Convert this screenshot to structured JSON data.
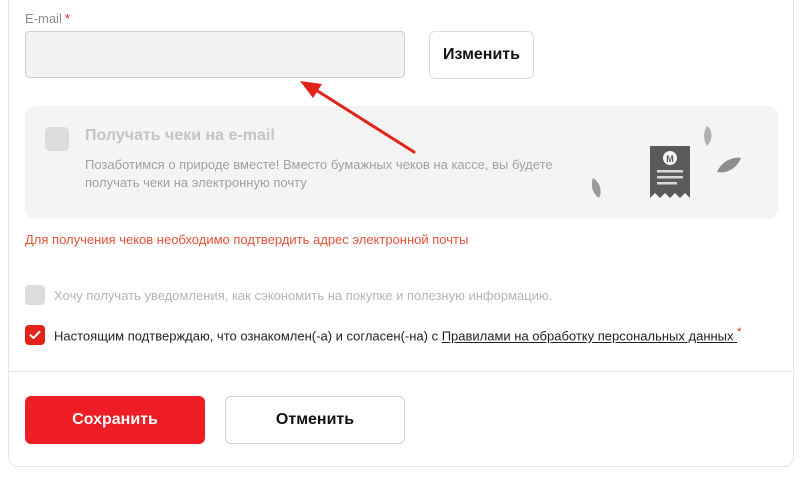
{
  "email": {
    "label": "E-mail",
    "required_mark": "*",
    "value": "",
    "change_button": "Изменить"
  },
  "receipts": {
    "title": "Получать чеки на e-mail",
    "description": "Позаботимся о природе вместе! Вместо бумажных чеков на кассе, вы будете получать чеки на электронную почту",
    "checked": false,
    "receipt_logo_letter": "M"
  },
  "hint": "Для получения чеков необходимо подтвердить адрес электронной почты",
  "options": {
    "notify_label": "Хочу получать уведомления, как сэкономить на покупке и полезную информацию.",
    "notify_checked": false,
    "consent_prefix": "Настоящим подтверждаю, что ознакомлен(-а) и согласен(-на) с ",
    "consent_link": "Правилами на обработку персональных данных ",
    "consent_required_mark": "*",
    "consent_checked": true
  },
  "actions": {
    "save_label": "Сохранить",
    "cancel_label": "Отменить"
  },
  "colors": {
    "accent": "#ee1c25",
    "hint": "#e4523b",
    "annotation_arrow": "#e2231a"
  },
  "icons": {
    "checkmark": "checkmark-icon",
    "receipt": "receipt-icon",
    "leaves": "leaf-icon"
  }
}
